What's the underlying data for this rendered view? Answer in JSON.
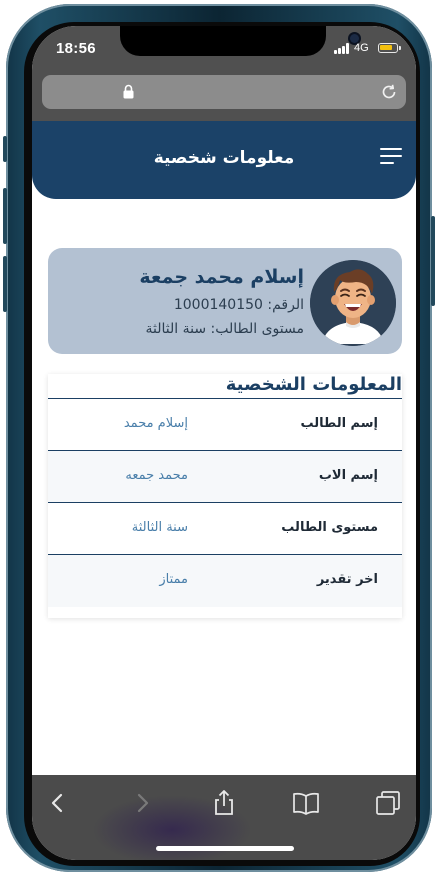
{
  "status_bar": {
    "time": "18:56",
    "network": "4G",
    "icons": [
      "signal-icon",
      "battery-icon"
    ],
    "battery_color": "#f2c00f"
  },
  "browser": {
    "icons": [
      "lock-icon",
      "reload-icon"
    ]
  },
  "app_header": {
    "title": "معلومات شخصية",
    "menu_icon": "hamburger-menu-icon",
    "color": "#1b4268"
  },
  "profile": {
    "name": "إسلام محمد جمعة",
    "id_line": "الرقم: 1000140150",
    "level_line": "مستوى الطالب: سنة الثالثة",
    "avatar_icon": "student-avatar-icon",
    "card_color": "#b3c1d2"
  },
  "personal_info": {
    "title": "المعلومات الشخصية",
    "rows": [
      {
        "label": "إسم الطالب",
        "value": "إسلام محمد"
      },
      {
        "label": "إسم الاب",
        "value": "محمد جمعه"
      },
      {
        "label": "مستوى الطالب",
        "value": "سنة الثالثة"
      },
      {
        "label": "اخر تقدير",
        "value": "ممتاز"
      }
    ],
    "value_color": "#4a7faa"
  },
  "browser_toolbar": {
    "icons": [
      "back-chevron-icon",
      "forward-chevron-icon",
      "share-icon",
      "bookmarks-icon",
      "tabs-icon"
    ]
  }
}
